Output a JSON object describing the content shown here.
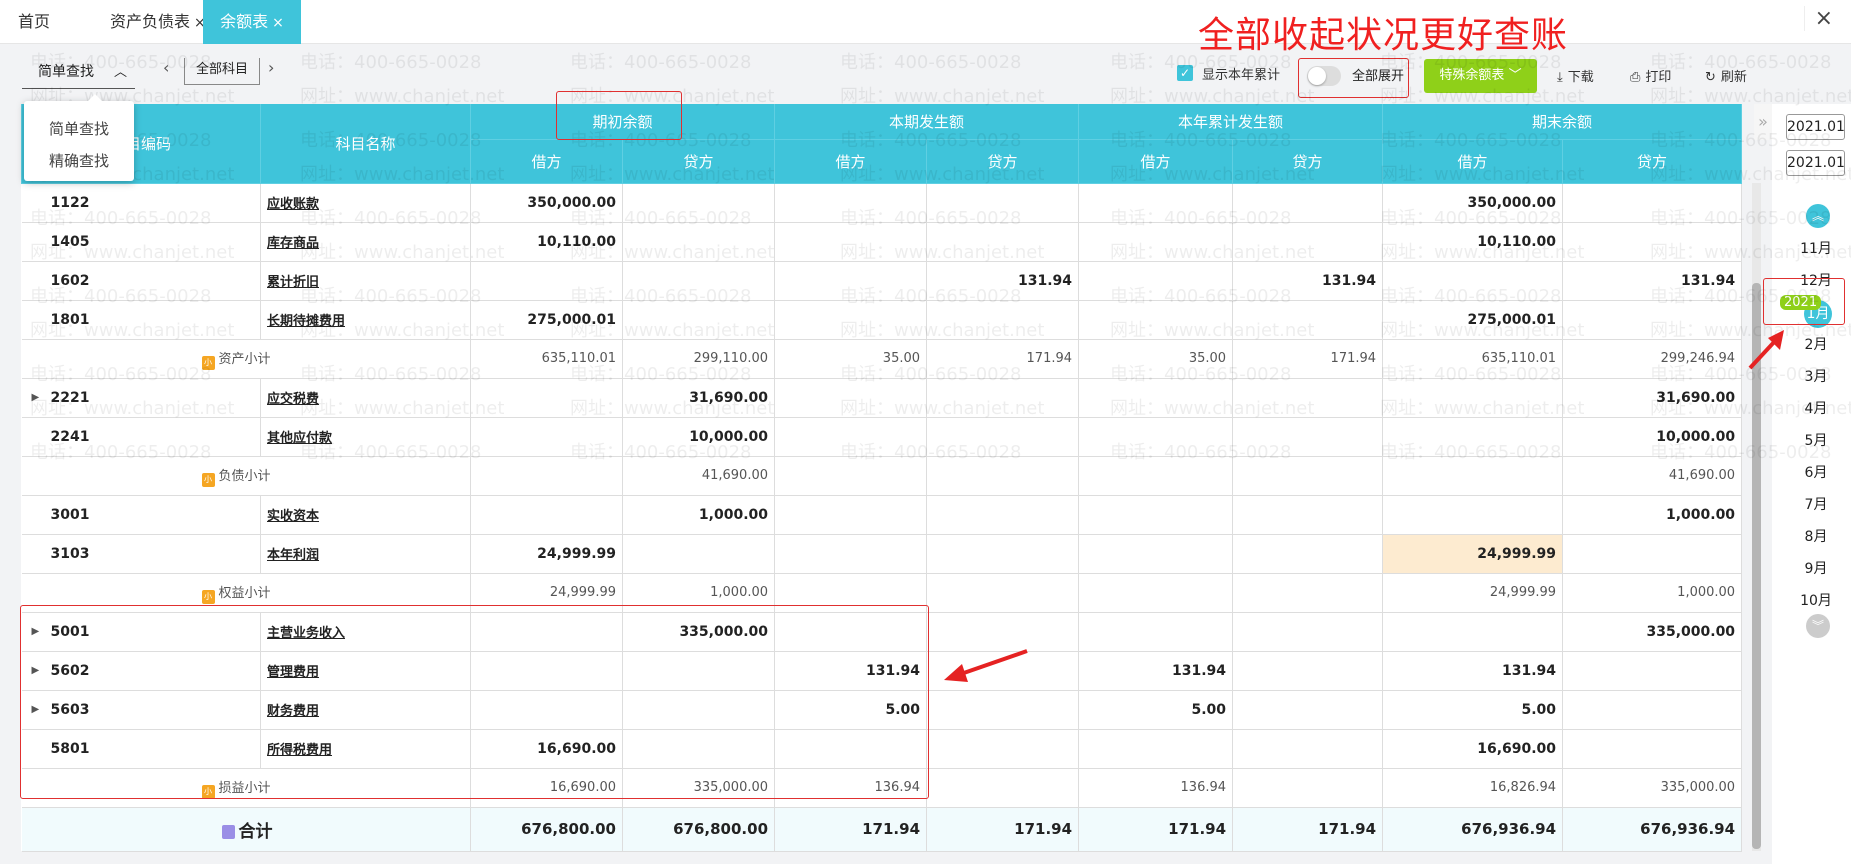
{
  "tabs": [
    {
      "label": "首页"
    },
    {
      "label": "资产负债表",
      "close": "×"
    },
    {
      "label": "余额表",
      "close": "×",
      "active": true
    }
  ],
  "window_close": "×",
  "annotation": "全部收起状况更好查账",
  "toolbar": {
    "search_mode": "简单查找",
    "search_options": [
      "简单查找",
      "精确查找"
    ],
    "subject": "全部科目",
    "show_ytd_label": "显示本年累计",
    "show_ytd_checked": true,
    "expand_all_label": "全部展开",
    "expand_all_on": false,
    "special_label": "特殊余额表",
    "download": "下载",
    "print": "打印",
    "refresh": "刷新"
  },
  "table": {
    "headers": {
      "code": "科目编码",
      "name": "科目名称",
      "groups": [
        "期初余额",
        "本期发生额",
        "本年累计发生额",
        "期末余额"
      ],
      "debit": "借方",
      "credit": "贷方"
    },
    "rows": [
      {
        "type": "row",
        "code": "1122",
        "name": "应收账款",
        "v": [
          "350,000.00",
          "",
          "",
          "",
          "",
          "",
          "350,000.00",
          ""
        ]
      },
      {
        "type": "row",
        "code": "1405",
        "name": "库存商品",
        "v": [
          "10,110.00",
          "",
          "",
          "",
          "",
          "",
          "10,110.00",
          ""
        ]
      },
      {
        "type": "row",
        "code": "1602",
        "name": "累计折旧",
        "v": [
          "",
          "",
          "",
          "131.94",
          "",
          "131.94",
          "",
          "131.94"
        ]
      },
      {
        "type": "row",
        "code": "1801",
        "name": "长期待摊费用",
        "v": [
          "275,000.01",
          "",
          "",
          "",
          "",
          "",
          "275,000.01",
          ""
        ]
      },
      {
        "type": "sub",
        "label": "资产小计",
        "v": [
          "635,110.01",
          "299,110.00",
          "35.00",
          "171.94",
          "35.00",
          "171.94",
          "635,110.01",
          "299,246.94"
        ]
      },
      {
        "type": "row",
        "code": "2221",
        "name": "应交税费",
        "expand": true,
        "v": [
          "",
          "31,690.00",
          "",
          "",
          "",
          "",
          "",
          "31,690.00"
        ]
      },
      {
        "type": "row",
        "code": "2241",
        "name": "其他应付款",
        "v": [
          "",
          "10,000.00",
          "",
          "",
          "",
          "",
          "",
          "10,000.00"
        ]
      },
      {
        "type": "sub",
        "label": "负债小计",
        "v": [
          "",
          "41,690.00",
          "",
          "",
          "",
          "",
          "",
          "41,690.00"
        ]
      },
      {
        "type": "row",
        "code": "3001",
        "name": "实收资本",
        "v": [
          "",
          "1,000.00",
          "",
          "",
          "",
          "",
          "",
          "1,000.00"
        ]
      },
      {
        "type": "row",
        "code": "3103",
        "name": "本年利润",
        "highlight": 6,
        "v": [
          "24,999.99",
          "",
          "",
          "",
          "",
          "",
          "24,999.99",
          ""
        ]
      },
      {
        "type": "sub",
        "label": "权益小计",
        "v": [
          "24,999.99",
          "1,000.00",
          "",
          "",
          "",
          "",
          "24,999.99",
          "1,000.00"
        ]
      },
      {
        "type": "row",
        "code": "5001",
        "name": "主营业务收入",
        "expand": true,
        "v": [
          "",
          "335,000.00",
          "",
          "",
          "",
          "",
          "",
          "335,000.00"
        ]
      },
      {
        "type": "row",
        "code": "5602",
        "name": "管理费用",
        "expand": true,
        "v": [
          "",
          "",
          "131.94",
          "",
          "131.94",
          "",
          "131.94",
          ""
        ]
      },
      {
        "type": "row",
        "code": "5603",
        "name": "财务费用",
        "expand": true,
        "v": [
          "",
          "",
          "5.00",
          "",
          "5.00",
          "",
          "5.00",
          ""
        ]
      },
      {
        "type": "row",
        "code": "5801",
        "name": "所得税费用",
        "v": [
          "16,690.00",
          "",
          "",
          "",
          "",
          "",
          "16,690.00",
          ""
        ]
      },
      {
        "type": "sub",
        "label": "损益小计",
        "v": [
          "16,690.00",
          "335,000.00",
          "136.94",
          "",
          "136.94",
          "",
          "16,826.94",
          "335,000.00"
        ]
      },
      {
        "type": "total",
        "label": "合计",
        "v": [
          "676,800.00",
          "676,800.00",
          "171.94",
          "171.94",
          "171.94",
          "171.94",
          "676,936.94",
          "676,936.94"
        ]
      }
    ],
    "subtotal_icon": "小",
    "highlight_color": "#fdebd0"
  },
  "period_panel": {
    "collapse": "»",
    "start": "2021.01",
    "end": "2021.01",
    "year_badge": "2021",
    "months": [
      "11月",
      "12月",
      "1月",
      "2月",
      "3月",
      "4月",
      "5月",
      "6月",
      "7月",
      "8月",
      "9月",
      "10月"
    ],
    "selected_month": "1月"
  },
  "watermark": {
    "phone": "电话：400-665-0028",
    "site": "网址：www.chanjet.net"
  },
  "colors": {
    "accent": "#3fc4da",
    "green": "#8fd019",
    "annotation": "#f02020"
  }
}
